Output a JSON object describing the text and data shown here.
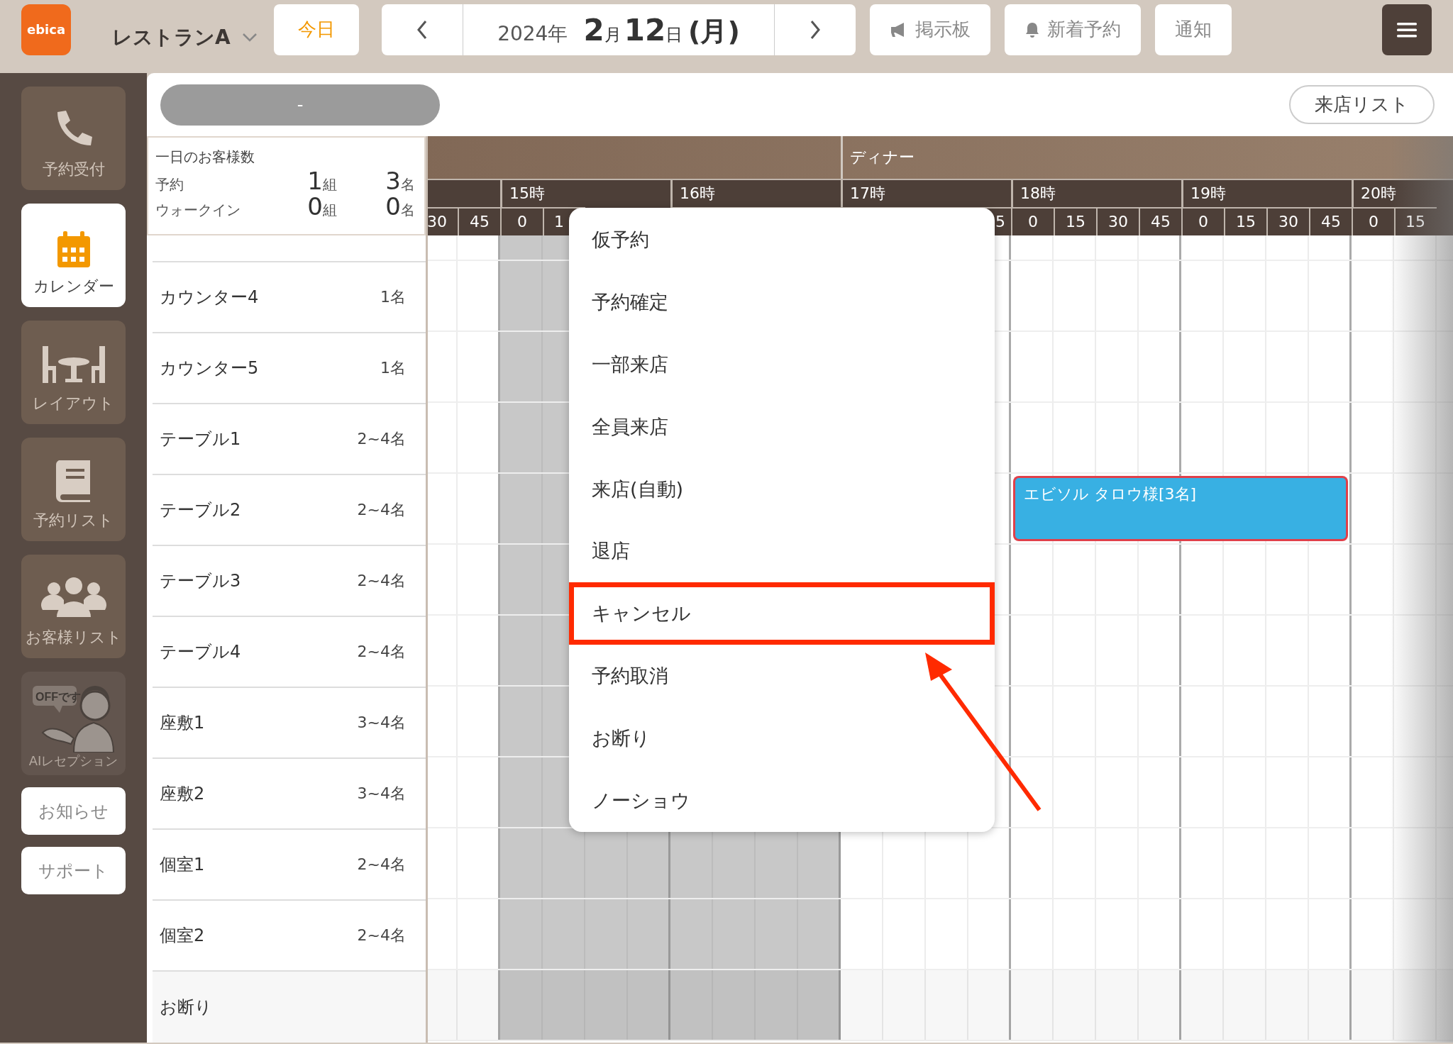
{
  "header": {
    "logo": "ebica",
    "store": "レストランA",
    "today_button": "今日",
    "date": {
      "year": "2024年",
      "month": "2",
      "month_unit": "月",
      "day": "12",
      "day_unit": "日",
      "weekday": "(月)"
    },
    "buttons": [
      {
        "kind": "megaphone",
        "label": "掲示板"
      },
      {
        "kind": "bell",
        "label": "新着予約"
      },
      {
        "kind": "none",
        "label": "通知"
      }
    ]
  },
  "sidebar": {
    "items": [
      {
        "kind": "phone",
        "label": "予約受付",
        "selected": false,
        "disabled": false
      },
      {
        "kind": "calendar",
        "label": "カレンダー",
        "selected": true,
        "disabled": false
      },
      {
        "kind": "layout",
        "label": "レイアウト",
        "selected": false,
        "disabled": false
      },
      {
        "kind": "book",
        "label": "予約リスト",
        "selected": false,
        "disabled": false
      },
      {
        "kind": "people",
        "label": "お客様リスト",
        "selected": false,
        "disabled": false
      },
      {
        "kind": "ai",
        "label": "AIレセプション",
        "bubble": "OFFです",
        "selected": false,
        "disabled": true
      }
    ],
    "buttons": [
      "お知らせ",
      "サポート"
    ]
  },
  "toolbar": {
    "pill": "-",
    "visit_list_button": "来店リスト"
  },
  "summary": {
    "title": "一日のお客様数",
    "rows": [
      {
        "label": "予約",
        "groups": "1",
        "groups_unit": "組",
        "people": "3",
        "people_unit": "名"
      },
      {
        "label": "ウォークイン",
        "groups": "0",
        "groups_unit": "組",
        "people": "0",
        "people_unit": "名"
      }
    ]
  },
  "timeline": {
    "period": "ディナー",
    "hours": [
      {
        "kind": "end",
        "quarters": [
          "30",
          "45"
        ],
        "closed": false
      },
      {
        "kind": "start",
        "label": "15時",
        "quarters": [
          "0",
          "1"
        ],
        "closed": true
      },
      {
        "kind": "start",
        "label": "16時",
        "closed": true
      },
      {
        "kind": "end",
        "label": "17時",
        "quarters": [
          "5"
        ],
        "closed": false
      },
      {
        "kind": "start",
        "label": "18時",
        "quarters": [
          "0",
          "15",
          "30",
          "45"
        ],
        "closed": false
      },
      {
        "kind": "start",
        "label": "19時",
        "quarters": [
          "0",
          "15",
          "30",
          "45"
        ],
        "closed": false
      },
      {
        "kind": "start",
        "label": "20時",
        "quarters": [
          "0",
          "15"
        ],
        "closed": false
      }
    ]
  },
  "seats": [
    {
      "kind": "seat",
      "name": "カウンター4",
      "capacity": "1名"
    },
    {
      "kind": "seat",
      "name": "カウンター5",
      "capacity": "1名"
    },
    {
      "kind": "seat",
      "name": "テーブル1",
      "capacity": "2~4名"
    },
    {
      "kind": "seat",
      "name": "テーブル2",
      "capacity": "2~4名",
      "booked_hours": [
        false,
        false,
        false,
        false,
        true,
        true,
        false
      ],
      "reservations": [
        {
          "label": "エビソル タロウ様[3名]",
          "selected": true
        }
      ]
    },
    {
      "kind": "seat",
      "name": "テーブル3",
      "capacity": "2~4名"
    },
    {
      "kind": "seat",
      "name": "テーブル4",
      "capacity": "2~4名"
    },
    {
      "kind": "seat",
      "name": "座敷1",
      "capacity": "3~4名"
    },
    {
      "kind": "seat",
      "name": "座敷2",
      "capacity": "3~4名"
    },
    {
      "kind": "seat",
      "name": "個室1",
      "capacity": "2~4名"
    },
    {
      "kind": "seat",
      "name": "個室2",
      "capacity": "2~4名"
    },
    {
      "kind": "refusal",
      "name": "お断り"
    }
  ],
  "context_menu": {
    "items": [
      {
        "label": "仮予約",
        "highlighted": false
      },
      {
        "label": "予約確定",
        "highlighted": false
      },
      {
        "label": "一部来店",
        "highlighted": false
      },
      {
        "label": "全員来店",
        "highlighted": false
      },
      {
        "label": "来店(自動)",
        "highlighted": false
      },
      {
        "label": "退店",
        "highlighted": false
      },
      {
        "label": "キャンセル",
        "highlighted": true
      },
      {
        "label": "予約取消",
        "highlighted": false
      },
      {
        "label": "お断り",
        "highlighted": false
      },
      {
        "label": "ノーショウ",
        "highlighted": false
      }
    ]
  }
}
